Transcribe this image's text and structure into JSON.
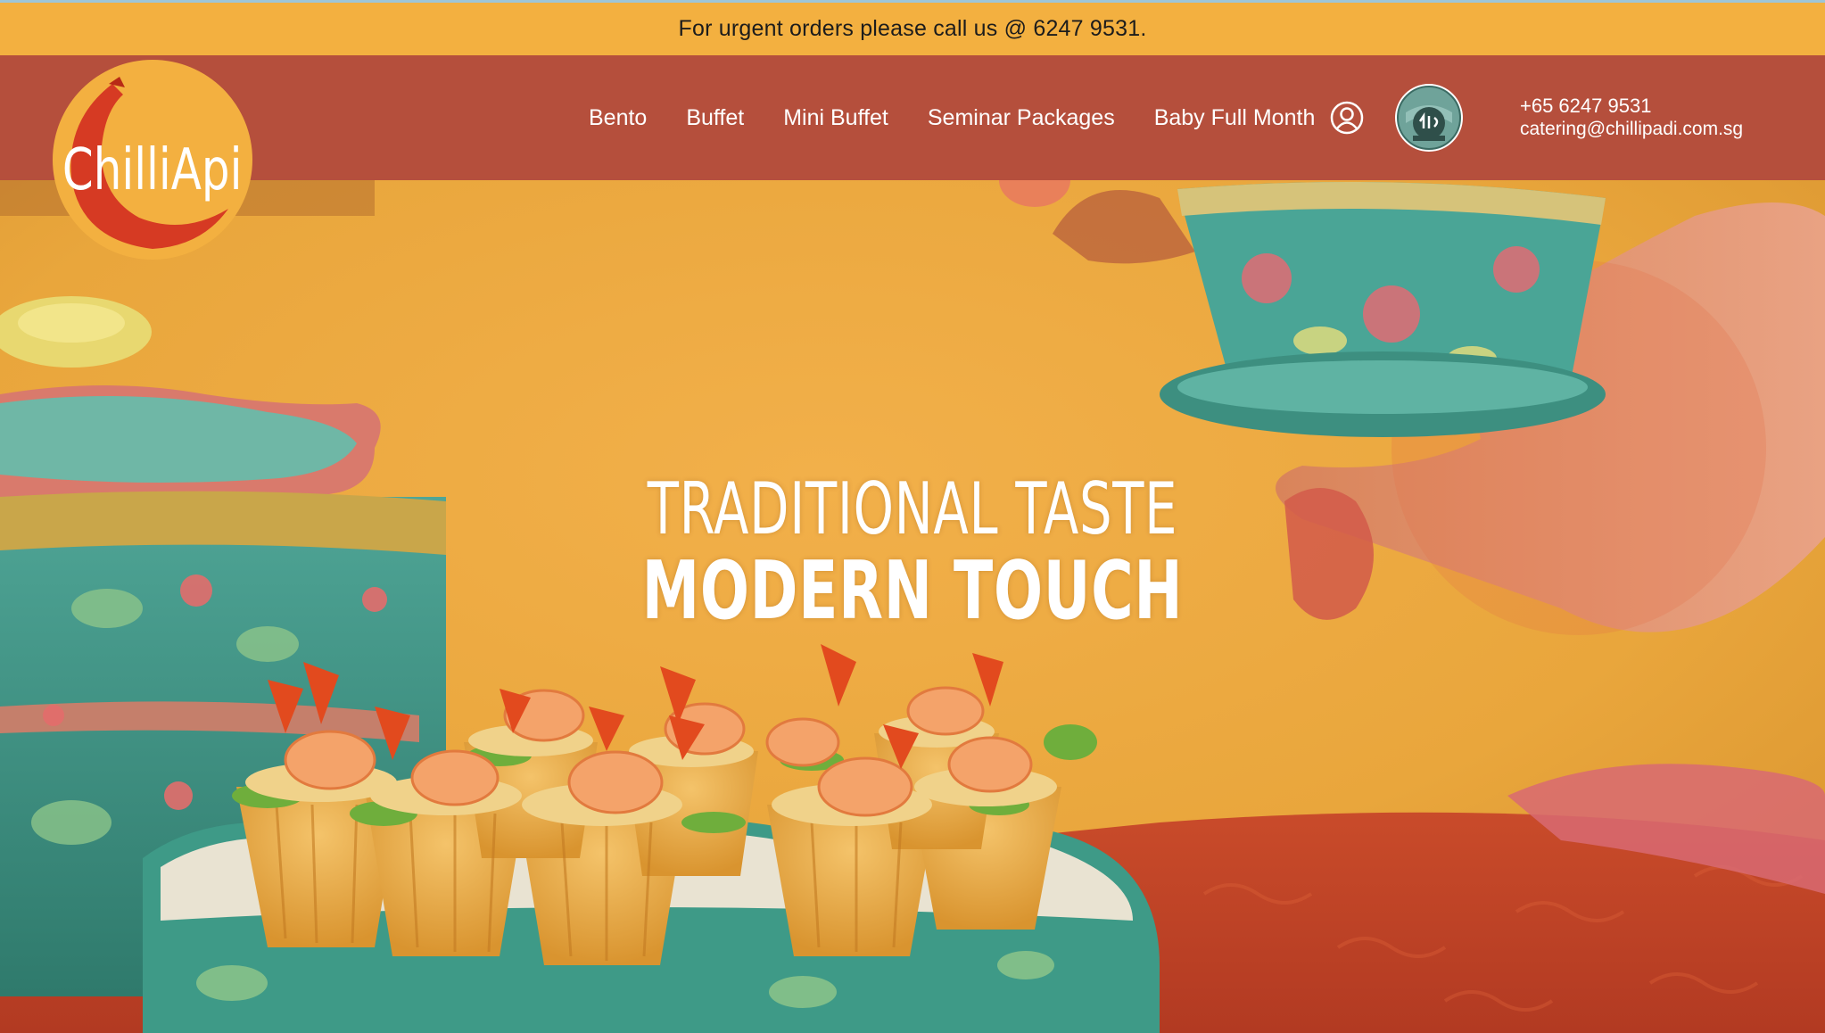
{
  "announcement": {
    "text": "For urgent orders please call us @ 6247 9531."
  },
  "brand": {
    "logo_text": "ChilliApi",
    "colors": {
      "header_bg": "#b54f3c",
      "topbar_bg": "#f3b040",
      "logo_ring": "#f3b040",
      "logo_chilli": "#d63a23"
    }
  },
  "nav": {
    "items": [
      {
        "label": "Bento"
      },
      {
        "label": "Buffet"
      },
      {
        "label": "Mini Buffet"
      },
      {
        "label": "Seminar Packages"
      },
      {
        "label": "Baby Full Month"
      }
    ]
  },
  "icons": {
    "account": "account-icon",
    "halal": "halal-certification-badge"
  },
  "contact": {
    "phone": "+65 6247 9531",
    "email": "catering@chillipadi.com.sg"
  },
  "hero": {
    "line1": "TRADITIONAL TASTE",
    "line2": "MODERN TOUCH"
  }
}
